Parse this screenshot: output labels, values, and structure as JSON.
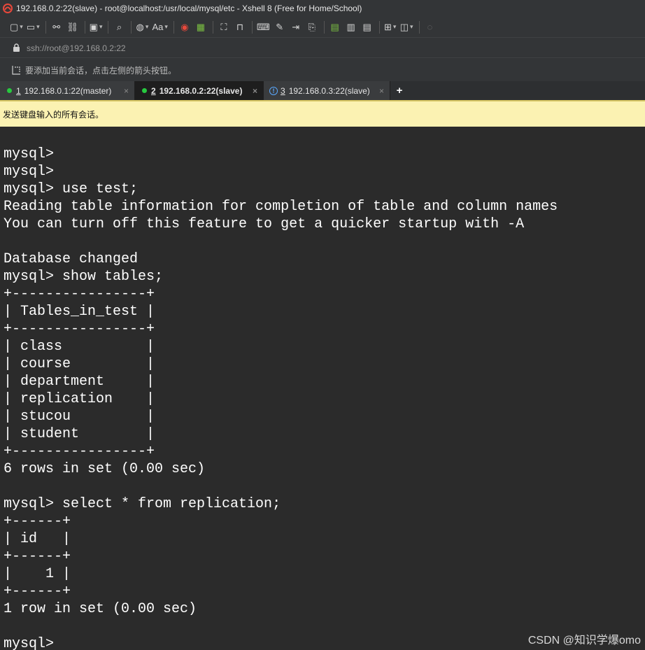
{
  "window": {
    "title": "192.168.0.2:22(slave) - root@localhost:/usr/local/mysql/etc - Xshell 8 (Free for Home/School)"
  },
  "toolbar": {
    "font_button_label": "Aa"
  },
  "address": {
    "url": "ssh://root@192.168.0.2:22"
  },
  "hint": {
    "text": "要添加当前会话，点击左侧的箭头按钮。"
  },
  "tabs": [
    {
      "number": "1",
      "label": "192.168.0.1:22(master)",
      "status": "connected"
    },
    {
      "number": "2",
      "label": "192.168.0.2:22(slave)",
      "status": "connected",
      "active": true
    },
    {
      "number": "3",
      "label": "192.168.0.3:22(slave)",
      "status": "warning"
    }
  ],
  "tab_add_label": "+",
  "tab_close_glyph": "×",
  "sendbar": {
    "text": "发送键盘输入的所有会话。"
  },
  "terminal": {
    "text": "mysql>\nmysql>\nmysql> use test;\nReading table information for completion of table and column names\nYou can turn off this feature to get a quicker startup with -A\n\nDatabase changed\nmysql> show tables;\n+----------------+\n| Tables_in_test |\n+----------------+\n| class          |\n| course         |\n| department     |\n| replication    |\n| stucou         |\n| student        |\n+----------------+\n6 rows in set (0.00 sec)\n\nmysql> select * from replication;\n+------+\n| id   |\n+------+\n|    1 |\n+------+\n1 row in set (0.00 sec)\n\nmysql>"
  },
  "watermark": "CSDN @知识学爆omo",
  "colors": {
    "connected": "#27c93f",
    "warning": "#5aa9ff",
    "sendbar_bg": "#fbf2b2",
    "terminal_bg": "#2b2b2b"
  }
}
